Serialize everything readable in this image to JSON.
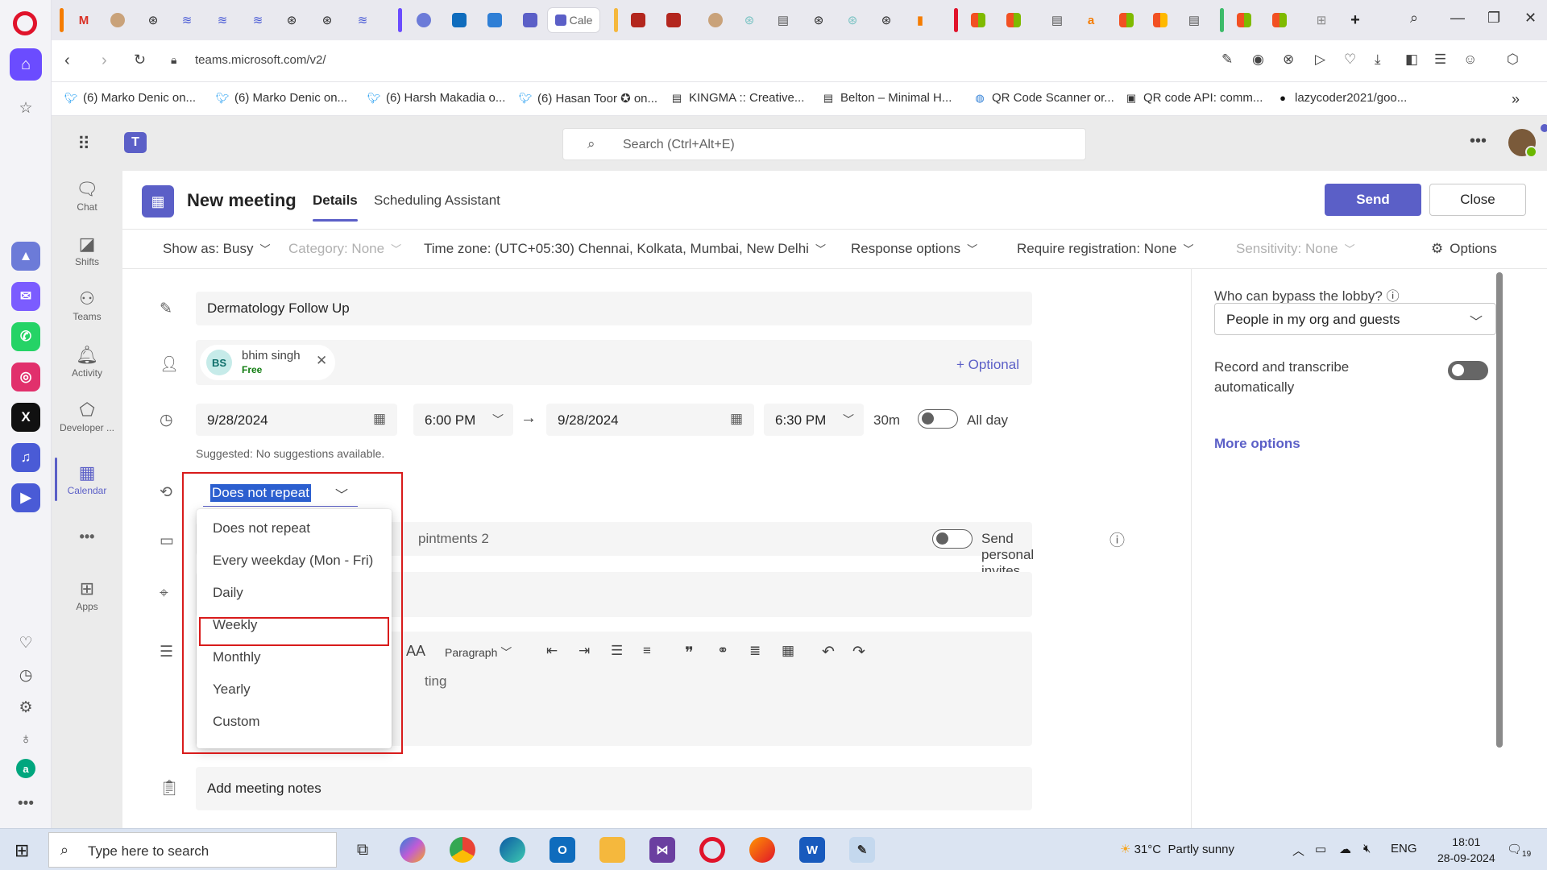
{
  "browser": {
    "url": "teams.microsoft.com/v2/",
    "active_tab_label": "Cale",
    "bookmarks": [
      "(6) Marko Denic on...",
      "(6) Marko Denic on...",
      "(6) Harsh Makadia o...",
      "(6) Hasan Toor ✪ on...",
      "KINGMA :: Creative...",
      "Belton – Minimal H...",
      "QR Code Scanner or...",
      "QR code API: comm...",
      "lazycoder2021/goo..."
    ]
  },
  "teams": {
    "search_placeholder": "Search (Ctrl+Alt+E)",
    "rail": [
      {
        "label": "Chat",
        "icon": "chat-icon"
      },
      {
        "label": "Shifts",
        "icon": "shifts-icon"
      },
      {
        "label": "Teams",
        "icon": "teams-icon"
      },
      {
        "label": "Activity",
        "icon": "bell-icon"
      },
      {
        "label": "Developer ...",
        "icon": "developer-icon"
      },
      {
        "label": "Calendar",
        "icon": "calendar-icon"
      },
      {
        "label": "Apps",
        "icon": "apps-icon"
      }
    ],
    "rail_more": "•••"
  },
  "meeting": {
    "title": "New meeting",
    "tabs": [
      "Details",
      "Scheduling Assistant"
    ],
    "send_label": "Send",
    "close_label": "Close",
    "options_bar": {
      "show_as": "Show as: Busy",
      "category": "Category: None",
      "time_zone": "Time zone: (UTC+05:30) Chennai, Kolkata, Mumbai, New Delhi",
      "response_options": "Response options",
      "require_registration": "Require registration: None",
      "sensitivity": "Sensitivity: None",
      "options": "Options"
    },
    "subject": "Dermatology Follow Up",
    "attendee": {
      "initials": "BS",
      "name": "bhim singh",
      "status": "Free"
    },
    "optional_label": "+ Optional",
    "start_date": "9/28/2024",
    "start_time": "6:00 PM",
    "end_date": "9/28/2024",
    "end_time": "6:30 PM",
    "duration": "30m",
    "all_day_label": "All day",
    "suggestion": "Suggested: No suggestions available.",
    "repeat_value": "Does not repeat",
    "repeat_options": [
      "Does not repeat",
      "Every weekday (Mon - Fri)",
      "Daily",
      "Weekly",
      "Monthly",
      "Yearly",
      "Custom"
    ],
    "highlighted_option": "Weekly",
    "channel_partial": "pintments 2",
    "send_personal_invites": "Send personal invites",
    "paragraph_label": "Paragraph",
    "details_partial": "ting",
    "notes_placeholder": "Add meeting notes"
  },
  "side_panel": {
    "lobby_label": "Who can bypass the lobby?",
    "lobby_value": "People in my org and guests",
    "record_label_1": "Record and transcribe",
    "record_label_2": "automatically",
    "more_options": "More options"
  },
  "taskbar": {
    "search_placeholder": "Type here to search",
    "weather_temp": "31°C",
    "weather_text": "Partly sunny",
    "language": "ENG",
    "time": "18:01",
    "date": "28-09-2024",
    "notifications": "19"
  },
  "colors": {
    "teams_accent": "#5b5fc7",
    "annotation_red": "#d81b1b",
    "selection_blue": "#2c5fcf"
  }
}
